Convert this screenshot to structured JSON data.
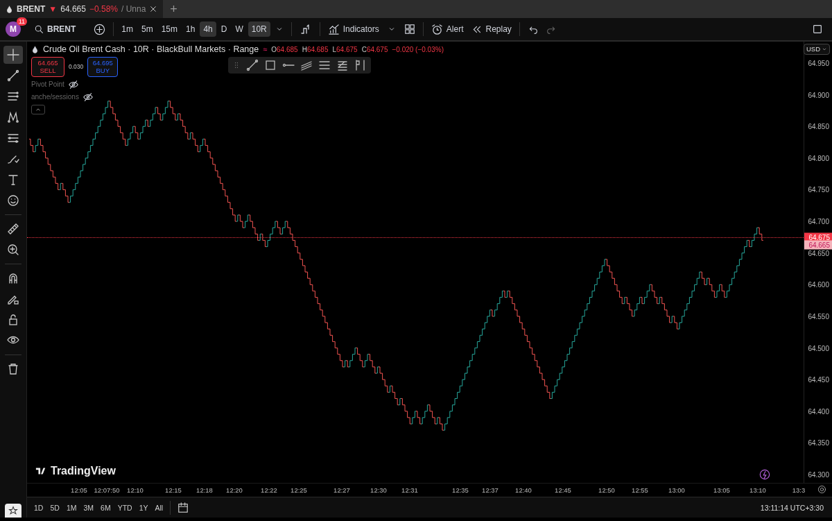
{
  "tabs": [
    {
      "symbol": "BRENT",
      "direction": "▼",
      "price": "64.665",
      "change": "−0.58%",
      "layout": "/ Unna",
      "selected": true
    }
  ],
  "new_tab": "+",
  "toolbar": {
    "avatar": "M",
    "notifications": "11",
    "symbol": "BRENT",
    "intervals": [
      {
        "label": "1m",
        "selected": false
      },
      {
        "label": "5m",
        "selected": false
      },
      {
        "label": "15m",
        "selected": false
      },
      {
        "label": "1h",
        "selected": false
      },
      {
        "label": "4h",
        "selected": true
      },
      {
        "label": "D",
        "selected": false
      },
      {
        "label": "W",
        "selected": false
      },
      {
        "label": "10R",
        "selected": true
      }
    ],
    "indicators": "Indicators",
    "alert": "Alert",
    "replay": "Replay"
  },
  "legend": {
    "status_icon": "≈",
    "title": "Crude Oil Brent Cash · 10R · BlackBull Markets · Range",
    "ohlc": [
      {
        "key": "O",
        "value": "64.685"
      },
      {
        "key": "H",
        "value": "64.685"
      },
      {
        "key": "L",
        "value": "64.675"
      },
      {
        "key": "C",
        "value": "64.675"
      }
    ],
    "change": "−0.020 (−0.03%)",
    "sell": {
      "price": "64.665",
      "label": "SELL"
    },
    "spread": "0.030",
    "buy": {
      "price": "64.695",
      "label": "BUY"
    },
    "studies": [
      {
        "name": "Pivot Point",
        "hidden": true
      },
      {
        "name": "anche/sessions",
        "hidden": true
      }
    ]
  },
  "left_tools": [
    {
      "selected": true
    },
    {
      "selected": false
    },
    {
      "selected": false
    },
    {
      "selected": false
    },
    {
      "selected": false
    },
    {
      "selected": false
    },
    {
      "selected": false
    },
    {
      "selected": false
    },
    {
      "selected": false
    },
    {
      "selected": false
    },
    {
      "selected": false
    },
    {
      "selected": false
    },
    {
      "selected": false
    },
    {
      "selected": false
    },
    {
      "selected": false
    }
  ],
  "price_axis": {
    "currency": "USD",
    "ticks": [
      "64.950",
      "64.900",
      "64.850",
      "64.800",
      "64.750",
      "64.700",
      "64.650",
      "64.600",
      "64.550",
      "64.500",
      "64.450",
      "64.400",
      "64.350",
      "64.300"
    ],
    "last_price": "64.675",
    "bid_price": "64.665"
  },
  "time_axis": [
    "12:05",
    "12:07:50",
    "12:10",
    "12:15",
    "12:18",
    "12:20",
    "12:22",
    "12:25",
    "12:27",
    "12:30",
    "12:31",
    "12:35",
    "12:37",
    "12:40",
    "12:45",
    "12:50",
    "12:55",
    "13:00",
    "13:05",
    "13:10",
    "13:3"
  ],
  "watermark_logo": "TradingView",
  "ranges": [
    "1D",
    "5D",
    "1M",
    "3M",
    "6M",
    "YTD",
    "1Y",
    "All"
  ],
  "clock": "13:11:14 UTC+3:30"
}
